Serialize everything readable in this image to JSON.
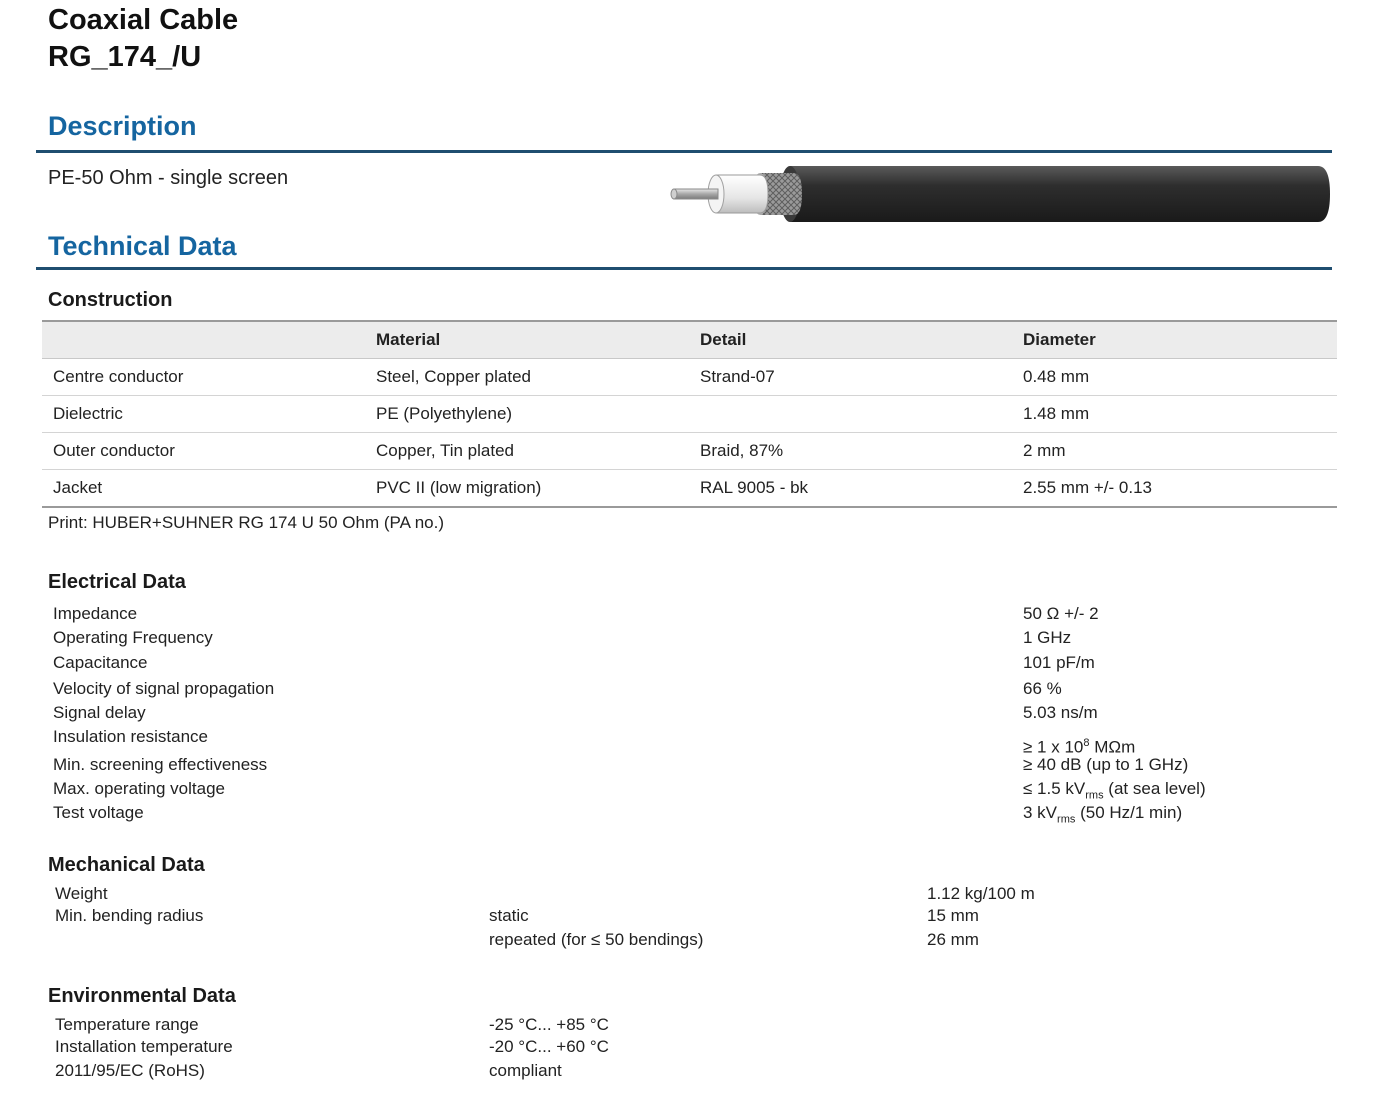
{
  "header": {
    "title_line1": "Coaxial Cable",
    "title_line2": "RG_174_/U"
  },
  "description": {
    "heading": "Description",
    "text": "PE-50 Ohm - single screen"
  },
  "technical": {
    "heading": "Technical Data"
  },
  "construction": {
    "heading": "Construction",
    "columns": [
      "",
      "Material",
      "Detail",
      "Diameter"
    ],
    "rows": [
      [
        "Centre conductor",
        "Steel, Copper plated",
        "Strand-07",
        "0.48 mm"
      ],
      [
        "Dielectric",
        "PE (Polyethylene)",
        "",
        "1.48 mm"
      ],
      [
        "Outer conductor",
        "Copper, Tin plated",
        "Braid, 87%",
        "2 mm"
      ],
      [
        "Jacket",
        "PVC II (low migration)",
        "RAL 9005 - bk",
        "2.55 mm +/- 0.13"
      ]
    ],
    "print_note": "Print: HUBER+SUHNER RG 174 U 50 Ohm (PA no.)"
  },
  "electrical": {
    "heading": "Electrical Data",
    "impedance_label": "Impedance",
    "impedance_value": "50 Ω +/- 2",
    "frequency_label": "Operating Frequency",
    "frequency_value": "1 GHz",
    "capacitance_label": "Capacitance",
    "capacitance_value": "101 pF/m",
    "velocity_label": "Velocity of signal propagation",
    "velocity_value": "66 %",
    "delay_label": "Signal delay",
    "delay_value": "5.03 ns/m",
    "insulation_label": "Insulation resistance",
    "insulation_prefix": "≥ 1 x 10",
    "insulation_exp": "8",
    "insulation_unit": " MΩm",
    "screening_label": "Min. screening effectiveness",
    "screening_value": "≥ 40 dB (up to 1 GHz)",
    "max_voltage_label": "Max. operating voltage",
    "max_voltage_prefix": "≤ 1.5 kV",
    "max_voltage_sub": "rms",
    "max_voltage_suffix": " (at sea level)",
    "test_voltage_label": "Test voltage",
    "test_voltage_prefix": "3 kV",
    "test_voltage_sub": "rms",
    "test_voltage_suffix": " (50 Hz/1 min)"
  },
  "mechanical": {
    "heading": "Mechanical Data",
    "weight_label": "Weight",
    "weight_value": "1.12 kg/100 m",
    "bending_label": "Min. bending radius",
    "static_label": "static",
    "static_value": "15 mm",
    "repeated_label": "repeated (for ≤ 50 bendings)",
    "repeated_value": "26 mm"
  },
  "environmental": {
    "heading": "Environmental Data",
    "temp_label": "Temperature range",
    "temp_value": "-25 °C... +85 °C",
    "install_label": "Installation temperature",
    "install_value": "-20 °C... +60 °C",
    "rohs_label": "2011/95/EC (RoHS)",
    "rohs_value": "compliant"
  },
  "colors": {
    "heading_blue": "#1565a0",
    "rule": "#1f4e70",
    "jacket": "#2e2e2e"
  }
}
